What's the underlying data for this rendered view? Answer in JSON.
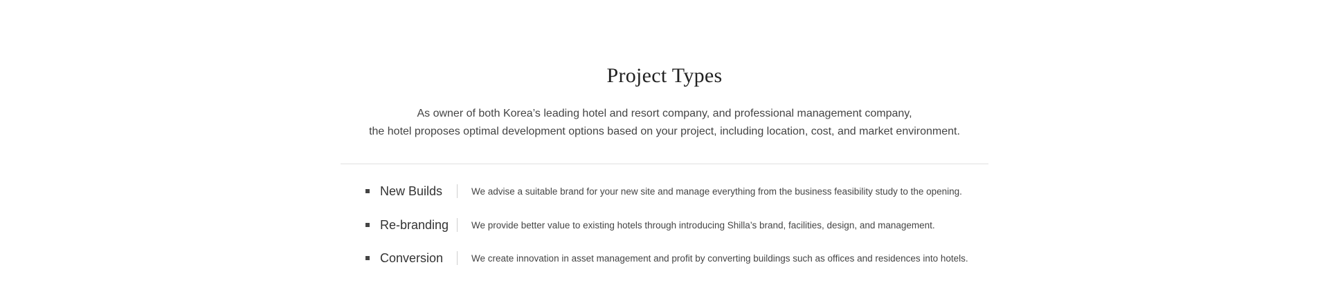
{
  "section": {
    "title": "Project Types",
    "intro_lines": [
      "As owner of both Korea’s leading hotel and resort company, and professional management company,",
      "the hotel proposes optimal development options based on your project, including location, cost, and market environment."
    ]
  },
  "types": [
    {
      "name": "New Builds",
      "description": "We advise a suitable brand for your new site and manage everything from the business feasibility study to the opening."
    },
    {
      "name": "Re-branding",
      "description": "We provide better value to existing hotels through introducing Shilla’s brand, facilities, design, and management."
    },
    {
      "name": "Conversion",
      "description": "We create innovation in asset management and profit by converting buildings such as offices and residences into hotels."
    }
  ]
}
